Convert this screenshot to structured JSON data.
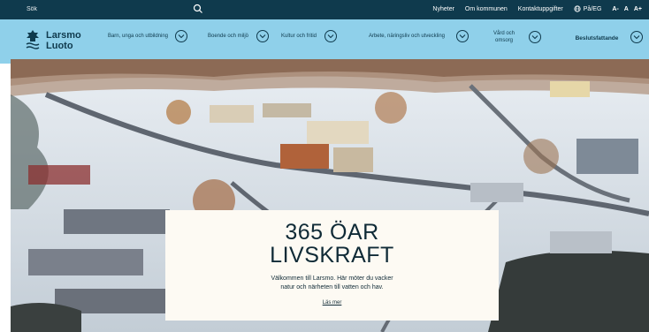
{
  "topbar": {
    "search_placeholder": "Sök",
    "links": [
      "Nyheter",
      "Om kommunen",
      "Kontaktuppgifter"
    ],
    "language": "På/EG",
    "font_sizes": [
      "A-",
      "A",
      "A+"
    ]
  },
  "nav": {
    "logo_line1": "Larsmo",
    "logo_line2": "Luoto",
    "items": [
      "Barn, unga och utbildning",
      "Boende och miljö",
      "Kultur och fritid",
      "Arbete, näringsliv och utveckling",
      "Vård och omsorg",
      "Beslutsfattande"
    ]
  },
  "hero": {
    "title_line1": "365 ÖAR",
    "title_line2": "LIVSKRAFT",
    "desc_line1": "Välkommen till Larsmo. Här möter du vacker",
    "desc_line2": "natur och närheten till vatten och hav.",
    "more_link": "Läs mer"
  },
  "colors": {
    "topbar_bg": "#0f3a4d",
    "nav_bg": "#8fd0ea",
    "card_bg": "#fdfaf3",
    "text_dark": "#0f2a36"
  }
}
